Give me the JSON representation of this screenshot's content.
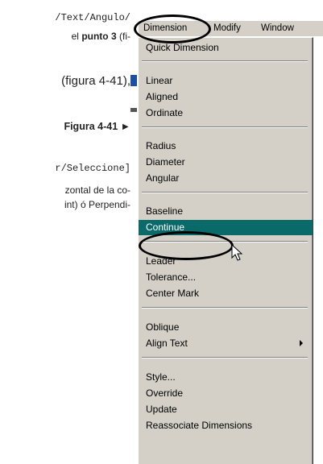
{
  "doc": {
    "line1": "/Text/Angulo/",
    "line2_pre": "el ",
    "line2_bold1": "punto",
    "line2_bold2": "3",
    "line2_post": " (fi-",
    "line3": "(figura 4-41),",
    "figure_label": "Figura 4-41 ►",
    "line4": "r/Seleccione]",
    "line5": "zontal de la co-",
    "line6": "int) ó Perpendi-"
  },
  "menubar": {
    "items": [
      {
        "label": "Dimension",
        "underline": "s",
        "active": true
      },
      {
        "label": "Modify",
        "underline": "M"
      },
      {
        "label": "Window",
        "underline": "W"
      }
    ]
  },
  "menu": {
    "groups": [
      [
        {
          "label": "Quick Dimension"
        }
      ],
      [
        {
          "label": "Linear"
        },
        {
          "label": "Aligned"
        },
        {
          "label": "Ordinate"
        }
      ],
      [
        {
          "label": "Radius"
        },
        {
          "label": "Diameter"
        },
        {
          "label": "Angular"
        }
      ],
      [
        {
          "label": "Baseline"
        },
        {
          "label": "Continue",
          "highlighted": true
        }
      ],
      [
        {
          "label": "Leader"
        },
        {
          "label": "Tolerance..."
        },
        {
          "label": "Center Mark"
        }
      ],
      [
        {
          "label": "Oblique"
        },
        {
          "label": "Align Text",
          "submenu": true
        }
      ],
      [
        {
          "label": "Style..."
        },
        {
          "label": "Override"
        },
        {
          "label": "Update"
        },
        {
          "label": "Reassociate Dimensions"
        }
      ]
    ]
  },
  "colors": {
    "menu_bg": "#d4d0c8",
    "highlight_bg": "#0a6a6a",
    "highlight_text": "#ffffff"
  }
}
